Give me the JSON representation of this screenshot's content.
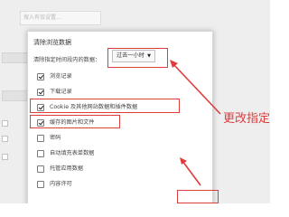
{
  "background": {
    "search_placeholder": "搜入有效设置...",
    "left_items": [
      "",
      ""
    ],
    "left_fragments": [
      "",
      "",
      "",
      ""
    ]
  },
  "dialog": {
    "title": "清除浏览数据",
    "range_label": "清除指定时间段内的数据：",
    "range_value": "过去一小时",
    "options": [
      {
        "label": "浏览记录",
        "checked": true
      },
      {
        "label": "下载记录",
        "checked": true
      },
      {
        "label": "Cookie 及其他网站数据和插件数据",
        "checked": true
      },
      {
        "label": "缓存的图片和文件",
        "checked": true
      },
      {
        "label": "密码",
        "checked": false
      },
      {
        "label": "自动填充表单数据",
        "checked": false
      },
      {
        "label": "托管应用数据",
        "checked": false
      },
      {
        "label": "内容许可",
        "checked": false
      }
    ]
  },
  "annotation": {
    "text": "更改指定时间",
    "color": "#e03b3b"
  }
}
